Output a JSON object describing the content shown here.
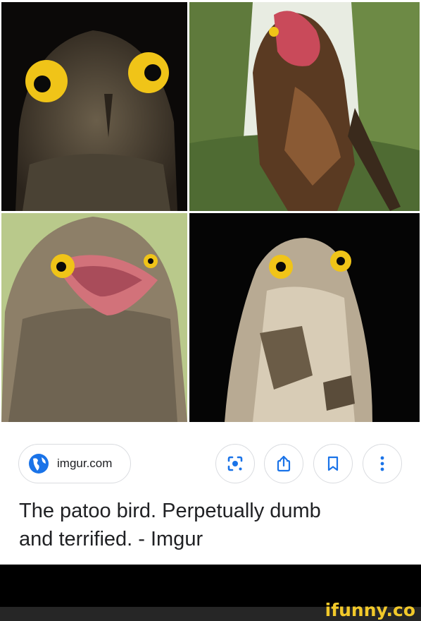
{
  "images": [
    {
      "name": "potoo-night-closeup"
    },
    {
      "name": "potoo-open-beak-forest"
    },
    {
      "name": "potoo-open-beak-green"
    },
    {
      "name": "potoo-night-upright"
    }
  ],
  "source": {
    "label": "imgur.com",
    "icon": "globe-icon"
  },
  "actions": [
    {
      "icon": "lens-search-icon"
    },
    {
      "icon": "share-icon"
    },
    {
      "icon": "bookmark-icon"
    },
    {
      "icon": "more-vertical-icon"
    }
  ],
  "caption": {
    "line1": "The patoo bird. Perpetually dumb",
    "line2": "and terrified. - Imgur"
  },
  "watermark": "ifunny.co",
  "colors": {
    "accent_blue": "#1a73e8",
    "watermark_yellow": "#f2c92a",
    "text": "#202124",
    "border": "#dadce0"
  }
}
